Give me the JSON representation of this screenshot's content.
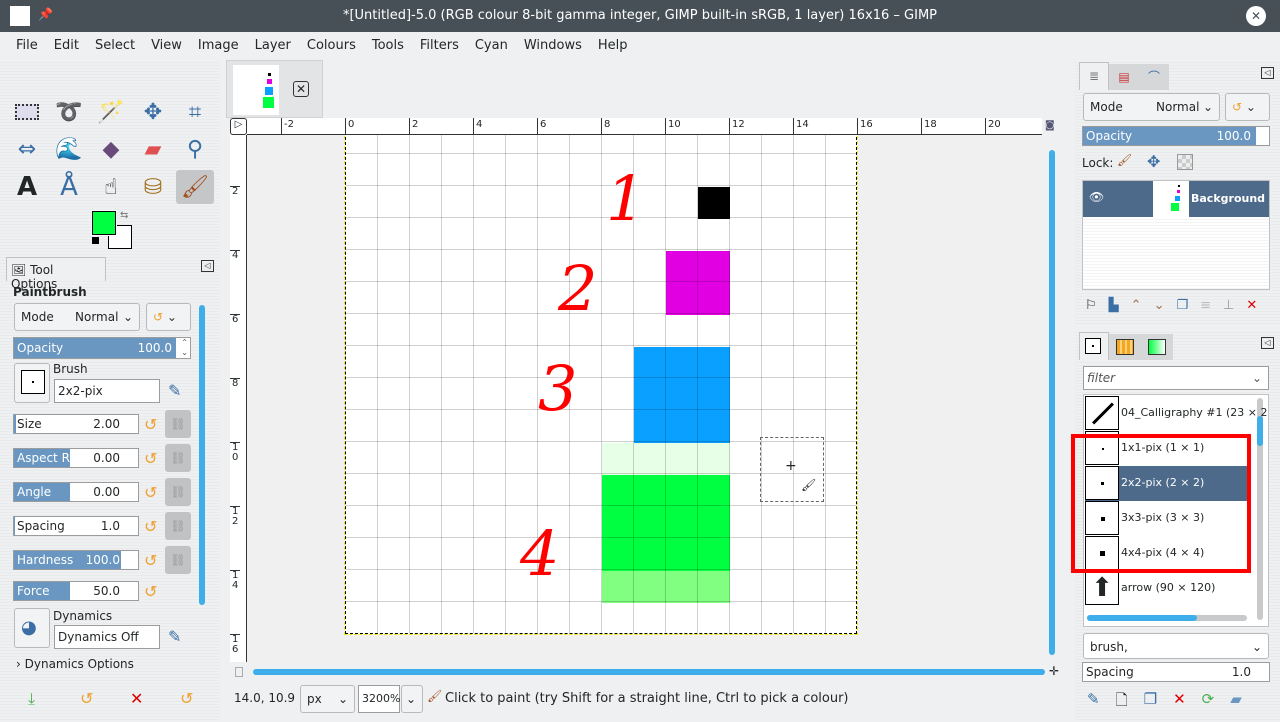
{
  "window": {
    "title": "*[Untitled]-5.0 (RGB colour 8-bit gamma integer, GIMP built-in sRGB, 1 layer) 16x16 – GIMP"
  },
  "menu": [
    "File",
    "Edit",
    "Select",
    "View",
    "Image",
    "Layer",
    "Colours",
    "Tools",
    "Filters",
    "Cyan",
    "Windows",
    "Help"
  ],
  "colors": {
    "fg": "#00ff40",
    "bg": "#ffffff",
    "accent": "#6a97c1",
    "selection": "#4d6a8a",
    "annotation": "#ff0000"
  },
  "tool_options": {
    "tab": "Tool Options",
    "tool": "Paintbrush",
    "mode_label": "Mode",
    "mode": "Normal",
    "opacity_label": "Opacity",
    "opacity": "100.0",
    "brush_label": "Brush",
    "brush": "2x2-pix",
    "size_label": "Size",
    "size": "2.00",
    "aspect_label": "Aspect Ratio",
    "aspect": "0.00",
    "angle_label": "Angle",
    "angle": "0.00",
    "spacing_label": "Spacing",
    "spacing": "1.0",
    "hardness_label": "Hardness",
    "hardness": "100.0",
    "force_label": "Force",
    "force": "50.0",
    "dynamics_label": "Dynamics",
    "dynamics": "Dynamics Off",
    "dynamics_options": "Dynamics Options"
  },
  "ruler": {
    "h": [
      "-2",
      "0",
      "2",
      "4",
      "6",
      "8",
      "10",
      "12",
      "14",
      "16",
      "18",
      "20"
    ],
    "v": [
      "2",
      "4",
      "6",
      "8",
      "10",
      "12",
      "14",
      "16"
    ]
  },
  "image": {
    "size": 16,
    "pixels": [
      {
        "col": 11,
        "row": 2,
        "w": 1,
        "h": 1,
        "color": "#000000"
      },
      {
        "col": 10,
        "row": 4,
        "w": 2,
        "h": 2,
        "color": "#e100e1"
      },
      {
        "col": 9,
        "row": 7,
        "w": 3,
        "h": 3,
        "color": "#0aa0ff"
      },
      {
        "col": 8,
        "row": 10,
        "w": 4,
        "h": 1,
        "color": "#e6ffe6"
      },
      {
        "col": 8,
        "row": 11,
        "w": 4,
        "h": 3,
        "color": "#00ff40"
      },
      {
        "col": 8,
        "row": 14,
        "w": 4,
        "h": 1,
        "color": "#80ff80"
      }
    ]
  },
  "annotations": [
    "1",
    "2",
    "3",
    "4"
  ],
  "status": {
    "coords": "14.0, 10.9",
    "unit": "px",
    "zoom": "3200%",
    "message": "Click to paint (try Shift for a straight line, Ctrl to pick a colour)"
  },
  "layers": {
    "mode_label": "Mode",
    "mode": "Normal",
    "opacity_label": "Opacity",
    "opacity": "100.0",
    "lock_label": "Lock:",
    "layer_name": "Background"
  },
  "brushes": {
    "filter_placeholder": "filter",
    "items": [
      "04_Calligraphy #1 (23 × 2",
      "1x1-pix (1 × 1)",
      "2x2-pix (2 × 2)",
      "3x3-pix (3 × 3)",
      "4x4-pix (4 × 4)",
      "arrow (90 × 120)"
    ],
    "selected": 2,
    "tag": "brush,",
    "spacing_label": "Spacing",
    "spacing": "1.0"
  }
}
